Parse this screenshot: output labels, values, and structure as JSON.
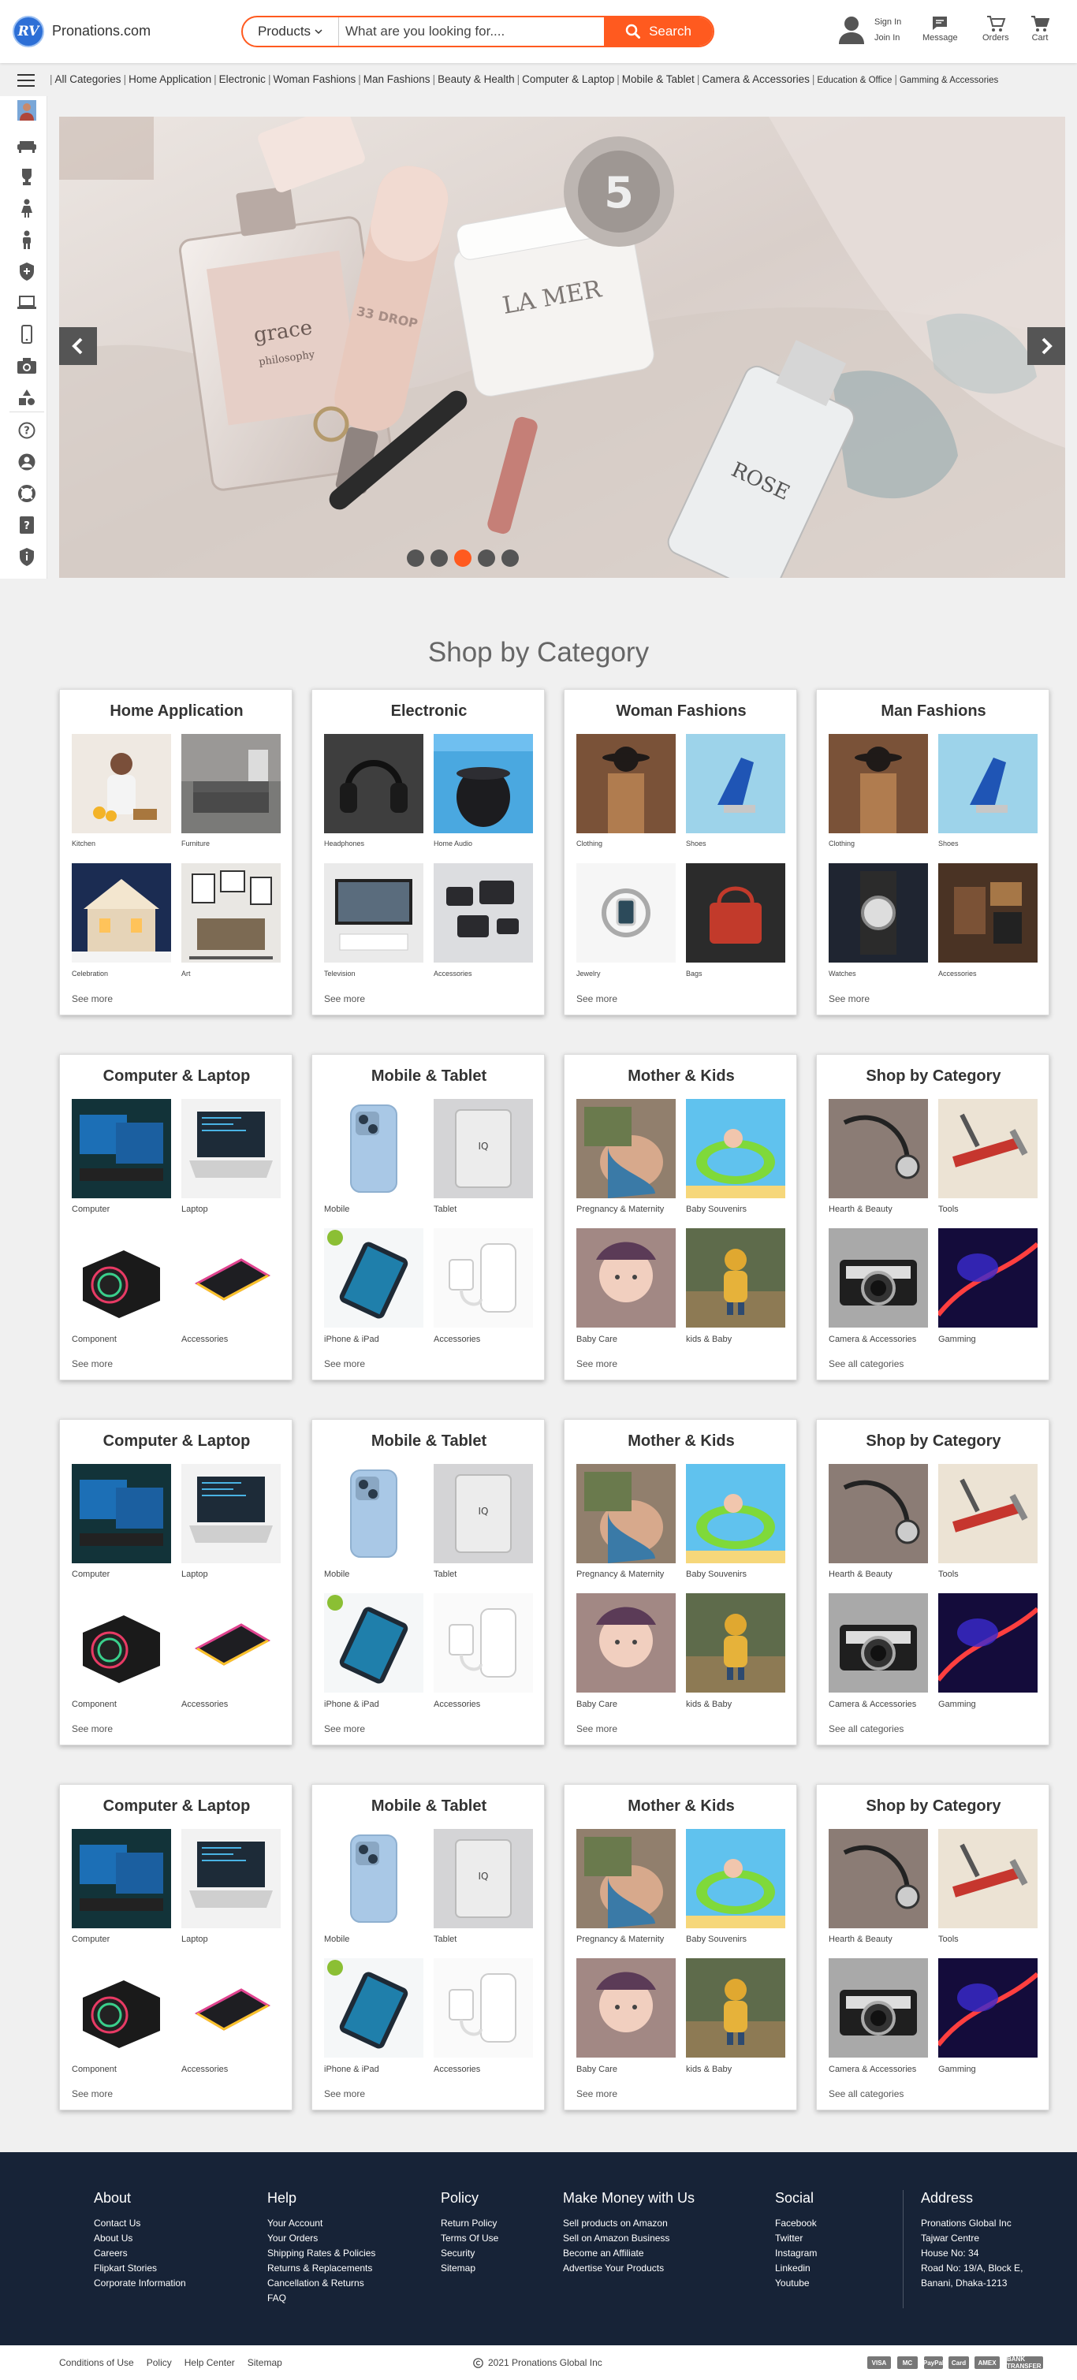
{
  "header": {
    "logo_badge": "RV",
    "logo_text": "Pronations.com",
    "search_category": "Products",
    "search_placeholder": "What are you looking for....",
    "search_button": "Search",
    "sign_in": "Sign In",
    "join_in": "Join In",
    "message": "Message",
    "orders": "Orders",
    "cart": "Cart"
  },
  "nav": {
    "categories": [
      "All Categories",
      "Home Application",
      "Electronic",
      "Woman Fashions",
      "Man Fashions",
      "Beauty & Health",
      "Computer & Laptop",
      "Mobile & Tablet",
      "Camera & Accessories",
      "Education & Office",
      "Gamming & Accessories"
    ]
  },
  "sidebar": {
    "icons": [
      "avatar",
      "sofa-icon",
      "trophy-icon",
      "woman-icon",
      "man-icon",
      "shield-icon",
      "laptop-icon",
      "mobile-icon",
      "camera-icon",
      "shapes-icon",
      "help-icon",
      "user-icon",
      "lifebuoy-icon",
      "question-icon",
      "info-shield-icon"
    ]
  },
  "slider": {
    "active_dot": 3,
    "dot_count": 5
  },
  "main": {
    "section_title": "Shop by Category",
    "rows": [
      {
        "cards": [
          {
            "title": "Home Application",
            "items": [
              "Kitchen",
              "Furniture",
              "Celebration",
              "Art"
            ],
            "link": "See more"
          },
          {
            "title": "Electronic",
            "items": [
              "Headphones",
              "Home Audio",
              "Television",
              "Accessories"
            ],
            "link": "See more"
          },
          {
            "title": "Woman Fashions",
            "items": [
              "Clothing",
              "Shoes",
              "Jewelry",
              "Bags"
            ],
            "link": "See more"
          },
          {
            "title": "Man Fashions",
            "items": [
              "Clothing",
              "Shoes",
              "Watches",
              "Accessories"
            ],
            "link": "See more"
          }
        ]
      },
      {
        "cards": [
          {
            "title": "Computer & Laptop",
            "items": [
              "Computer",
              "Laptop",
              "Component",
              "Accessories"
            ],
            "link": "See more"
          },
          {
            "title": "Mobile & Tablet",
            "items": [
              "Mobile",
              "Tablet",
              "iPhone & iPad",
              "Accessories"
            ],
            "link": "See more"
          },
          {
            "title": "Mother & Kids",
            "items": [
              "Pregnancy & Maternity",
              "Baby Souvenirs",
              "Baby Care",
              "kids & Baby"
            ],
            "link": "See more"
          },
          {
            "title": "Shop by Category",
            "items": [
              "Hearth & Beauty",
              "Tools",
              "Camera & Accessories",
              "Gamming"
            ],
            "link": "See all categories"
          }
        ]
      },
      {
        "cards": [
          {
            "title": "Computer & Laptop",
            "items": [
              "Computer",
              "Laptop",
              "Component",
              "Accessories"
            ],
            "link": "See more"
          },
          {
            "title": "Mobile & Tablet",
            "items": [
              "Mobile",
              "Tablet",
              "iPhone & iPad",
              "Accessories"
            ],
            "link": "See more"
          },
          {
            "title": "Mother & Kids",
            "items": [
              "Pregnancy & Maternity",
              "Baby Souvenirs",
              "Baby Care",
              "kids & Baby"
            ],
            "link": "See more"
          },
          {
            "title": "Shop by Category",
            "items": [
              "Hearth & Beauty",
              "Tools",
              "Camera & Accessories",
              "Gamming"
            ],
            "link": "See all categories"
          }
        ]
      },
      {
        "cards": [
          {
            "title": "Computer & Laptop",
            "items": [
              "Computer",
              "Laptop",
              "Component",
              "Accessories"
            ],
            "link": "See more"
          },
          {
            "title": "Mobile & Tablet",
            "items": [
              "Mobile",
              "Tablet",
              "iPhone & iPad",
              "Accessories"
            ],
            "link": "See more"
          },
          {
            "title": "Mother & Kids",
            "items": [
              "Pregnancy & Maternity",
              "Baby Souvenirs",
              "Baby Care",
              "kids & Baby"
            ],
            "link": "See more"
          },
          {
            "title": "Shop by Category",
            "items": [
              "Hearth & Beauty",
              "Tools",
              "Camera & Accessories",
              "Gamming"
            ],
            "link": "See all categories"
          }
        ]
      }
    ]
  },
  "footer": {
    "about": {
      "title": "About",
      "links": [
        "Contact Us",
        "About Us",
        "Careers",
        "Flipkart Stories",
        "Corporate Information"
      ]
    },
    "help": {
      "title": "Help",
      "links": [
        "Your Account",
        "Your Orders",
        "Shipping Rates & Policies",
        "Returns & Replacements",
        "Cancellation & Returns",
        "FAQ"
      ]
    },
    "policy": {
      "title": "Policy",
      "links": [
        "Return Policy",
        "Terms Of Use",
        "Security",
        "Sitemap"
      ]
    },
    "money": {
      "title": "Make Money with Us",
      "links": [
        "Sell products on Amazon",
        "Sell on Amazon Business",
        "Become an Affiliate",
        "Advertise Your Products"
      ]
    },
    "social": {
      "title": "Social",
      "links": [
        "Facebook",
        "Twitter",
        "Instagram",
        "Linkedin",
        "Youtube"
      ]
    },
    "address": {
      "title": "Address",
      "lines": [
        "Pronations Global Inc",
        "Tajwar Centre",
        "House No: 34",
        "Road No: 19/A, Block E,",
        "Banani, Dhaka-1213"
      ]
    }
  },
  "bottom": {
    "links": [
      "Conditions of Use",
      "Policy",
      "Help Center",
      "Sitemap"
    ],
    "copyright": "2021 Pronations Global Inc",
    "payments": [
      "VISA",
      "MC",
      "PayPal",
      "Card",
      "AMEX",
      "BANK TRANSFER"
    ]
  },
  "colors": {
    "accent": "#ff5a1f",
    "footer": "#172337",
    "brand": "#2d6fd6"
  }
}
